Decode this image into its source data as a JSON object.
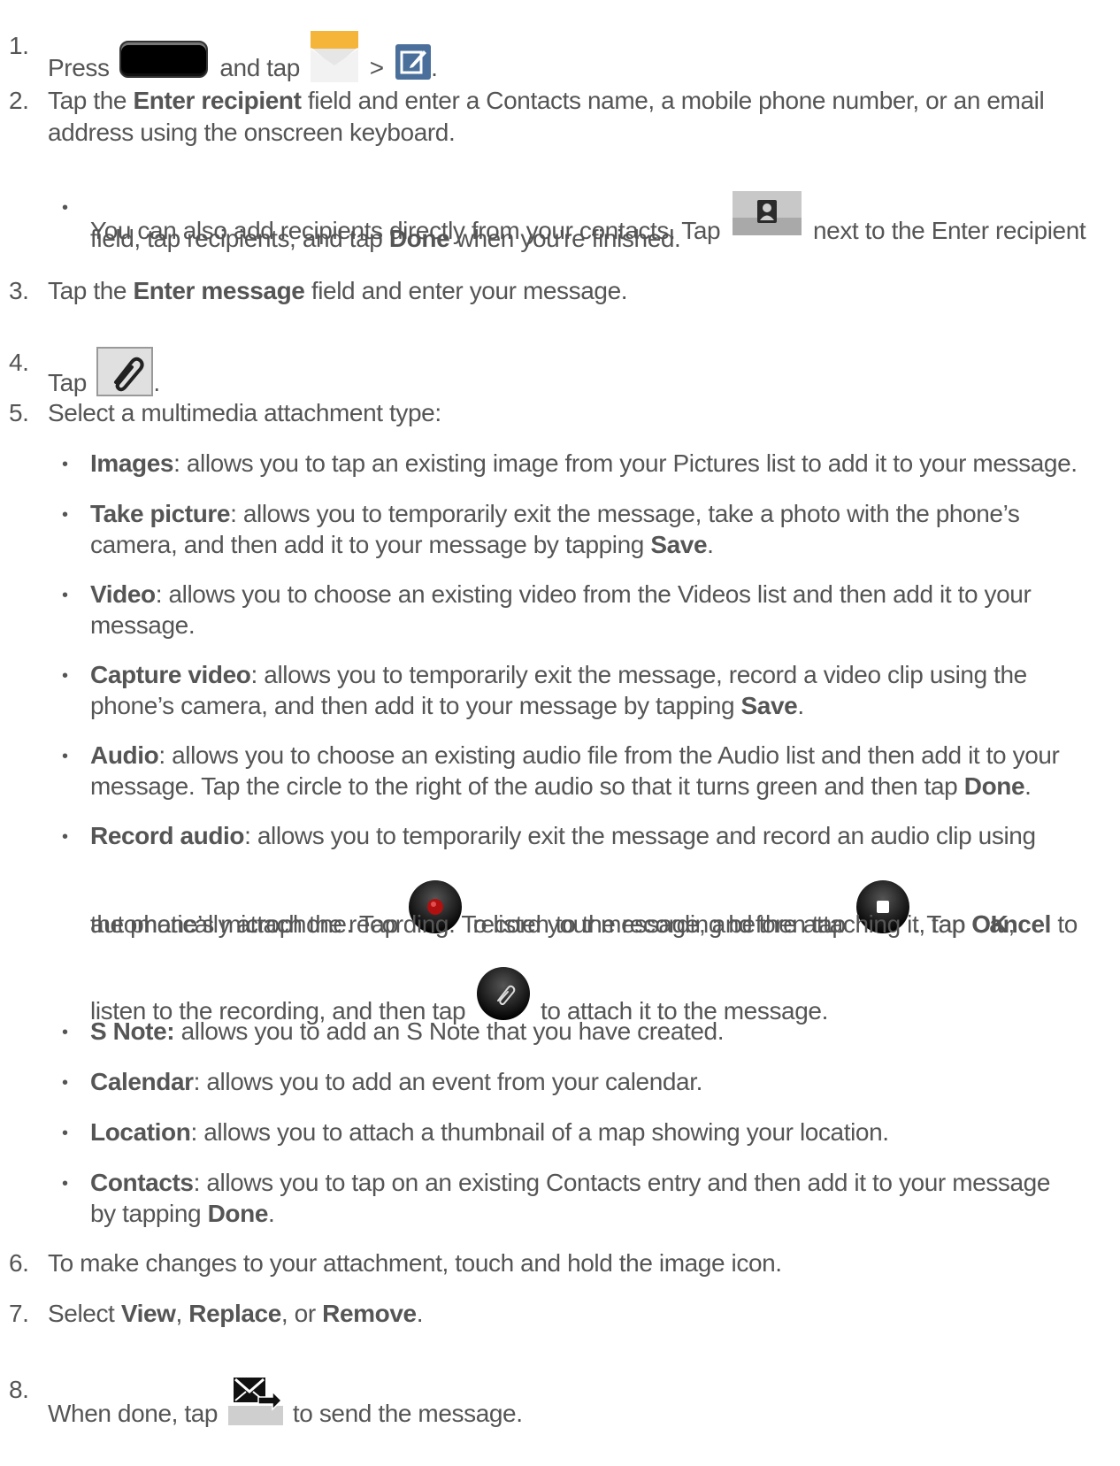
{
  "steps": [
    {
      "num": "1.",
      "a": "Press",
      "b": "and tap",
      "c": ">",
      "d": "."
    },
    {
      "num": "2.",
      "pre": "Tap the",
      "bold": "Enter recipient",
      "post": "field and enter a Contacts name, a mobile phone number, or an email",
      "line2": "address using the onscreen keyboard."
    },
    {
      "num": "3.",
      "pre": "Tap the",
      "bold": "Enter message",
      "post": "field and enter your message."
    },
    {
      "num": "4.",
      "pre": "Tap",
      "post": "."
    },
    {
      "num": "5.",
      "text": "Select a multimedia attachment type:"
    },
    {
      "num": "6.",
      "text": "To make changes to your attachment, touch and hold the image icon."
    },
    {
      "num": "7.",
      "pre": "Select",
      "b1": "View",
      "s1": ",",
      "b2": "Replace",
      "s2": ", or",
      "b3": "Remove",
      "s3": "."
    },
    {
      "num": "8.",
      "pre": "When done, tap",
      "post": "to send the message."
    }
  ],
  "step2_bullet": {
    "pre": "You can also add recipients directly from your contacts. Tap",
    "post": "next to the Enter recipient",
    "line2_pre": "field, tap recipients, and tap",
    "line2_bold": "Done",
    "line2_post": "when you're finished."
  },
  "attachments": {
    "images": {
      "label": "Images",
      "text": ": allows you to tap an existing image from your Pictures list to add it to your message."
    },
    "take_picture": {
      "label": "Take picture",
      "text": ": allows you to temporarily exit the message, take a photo with the phone’s",
      "line2": "camera, and then add it to your message by tapping",
      "bold2": "Save",
      "end2": "."
    },
    "video": {
      "label": "Video",
      "text": ": allows you to choose an existing video from the Videos list and then add it to your",
      "line2": "message."
    },
    "capture_video": {
      "label": "Capture video",
      "text": ": allows you to temporarily exit the message, record a video clip using the",
      "line2": "phone’s camera, and then add it to your message by tapping",
      "bold2": "Save",
      "end2": "."
    },
    "audio": {
      "label": "Audio",
      "text": ": allows you to choose an existing audio file from the Audio list and then add it to your",
      "line2": "message. Tap the circle to the right of the audio so that it turns green and then tap",
      "bold2": "Done",
      "end2": "."
    },
    "record_audio": {
      "label": "Record audio",
      "text": ": allows you to temporarily exit the message and record an audio clip using",
      "l2a": "the phone’s microphone. Tap",
      "l2b": "record your message, and then tap",
      "l2c": ". Tap",
      "l2bold": "Cancel",
      "l2d": "to",
      "l3a": "automatically attach the recording. To listen to the recording before attaching it, tap",
      "l3bold": "OK",
      "l3b": ",",
      "l4a": "listen to the recording, and then tap",
      "l4b": "to attach it to the message."
    },
    "s_note": {
      "label": "S Note:",
      "text": "allows you to add an S Note that you have created."
    },
    "calendar": {
      "label": "Calendar",
      "text": ": allows you to add an event from your calendar."
    },
    "location": {
      "label": "Location",
      "text": ": allows you to attach a thumbnail of a map showing your location."
    },
    "contacts": {
      "label": "Contacts",
      "text": ": allows you to tap on an existing Contacts entry and then add it to your message",
      "line2": "by tapping",
      "bold2": "Done",
      "end2": "."
    }
  },
  "bullet_char": "•",
  "colors": {
    "text": "#555555",
    "record_red": "#b01010",
    "icon_blue": "#4a6f9a"
  }
}
